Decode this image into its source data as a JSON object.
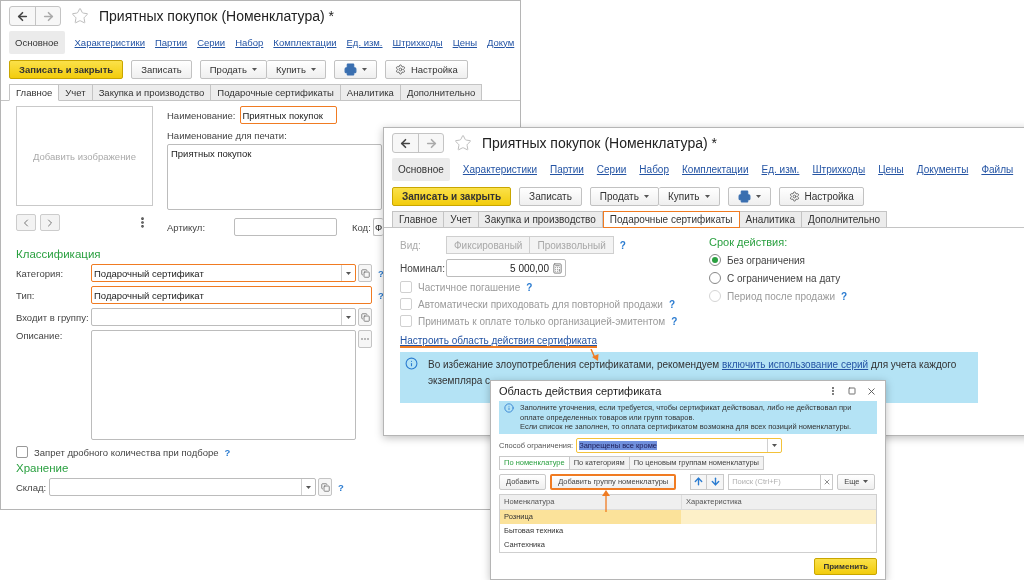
{
  "back_window": {
    "title": "Приятных покупок (Номенклатура) *",
    "nav": [
      {
        "label": "Основное",
        "selected": true
      },
      {
        "label": "Характеристики",
        "selected": false
      },
      {
        "label": "Партии",
        "selected": false
      },
      {
        "label": "Серии",
        "selected": false
      },
      {
        "label": "Набор",
        "selected": false
      },
      {
        "label": "Комплектации",
        "selected": false
      },
      {
        "label": "Ед. изм.",
        "selected": false
      },
      {
        "label": "Штрихкоды",
        "selected": false
      },
      {
        "label": "Цены",
        "selected": false
      },
      {
        "label": "Докум",
        "selected": false
      }
    ],
    "commands": [
      {
        "kind": "primary",
        "label": "Записать и закрыть"
      },
      {
        "kind": "plain",
        "label": "Записать"
      },
      {
        "kind": "menu",
        "label": "Продать"
      },
      {
        "kind": "menu",
        "label": "Купить"
      },
      {
        "kind": "print"
      },
      {
        "kind": "settings",
        "label": "Настройка"
      }
    ],
    "tabs": [
      {
        "label": "Главное",
        "selected": true,
        "highlighted": false
      },
      {
        "label": "Учет",
        "selected": false,
        "highlighted": false
      },
      {
        "label": "Закупка и производство",
        "selected": false,
        "highlighted": false
      },
      {
        "label": "Подарочные сертификаты",
        "selected": false,
        "highlighted": false
      },
      {
        "label": "Аналитика",
        "selected": false,
        "highlighted": false
      },
      {
        "label": "Дополнительно",
        "selected": false,
        "highlighted": false
      }
    ],
    "image_placeholder": "Добавить изображение",
    "name_field": {
      "label": "Наименование:",
      "value": "Приятных покупок",
      "highlighted": true
    },
    "print_name": {
      "label": "Наименование для печати:",
      "value": "Приятных покупок"
    },
    "article": {
      "label": "Артикул:"
    },
    "code": {
      "label": "Код:",
      "value": "Ф"
    },
    "classification": {
      "title": "Классификация",
      "fields": [
        {
          "kind": "select",
          "label": "Категория:",
          "value": "Подарочный сертификат",
          "highlighted": true,
          "help": "?"
        },
        {
          "kind": "text",
          "label": "Тип:",
          "value": "Подарочный сертификат",
          "highlighted": true,
          "help": "?"
        },
        {
          "kind": "select",
          "label": "Входит в группу:",
          "highlighted": false
        },
        {
          "kind": "memo",
          "label": "Описание:",
          "highlighted": false
        }
      ]
    },
    "fractional": {
      "label": "Запрет дробного количества при подборе",
      "checked": false,
      "help": "?"
    },
    "storage": {
      "title": "Хранение",
      "field": {
        "kind": "select",
        "label": "Склад:",
        "highlighted": false,
        "help": "?"
      }
    }
  },
  "front_window": {
    "title": "Приятных покупок (Номенклатура) *",
    "nav": [
      {
        "label": "Основное",
        "selected": true
      },
      {
        "label": "Характеристики",
        "selected": false
      },
      {
        "label": "Партии",
        "selected": false
      },
      {
        "label": "Серии",
        "selected": false
      },
      {
        "label": "Набор",
        "selected": false
      },
      {
        "label": "Комплектации",
        "selected": false
      },
      {
        "label": "Ед. изм.",
        "selected": false
      },
      {
        "label": "Штрихкоды",
        "selected": false
      },
      {
        "label": "Цены",
        "selected": false
      },
      {
        "label": "Документы",
        "selected": false
      },
      {
        "label": "Файлы",
        "selected": false
      }
    ],
    "commands": [
      {
        "kind": "primary",
        "label": "Записать и закрыть"
      },
      {
        "kind": "plain",
        "label": "Записать"
      },
      {
        "kind": "menu",
        "label": "Продать"
      },
      {
        "kind": "menu",
        "label": "Купить"
      },
      {
        "kind": "print"
      },
      {
        "kind": "settings",
        "label": "Настройка"
      }
    ],
    "tabs": [
      {
        "label": "Главное",
        "selected": false,
        "highlighted": false
      },
      {
        "label": "Учет",
        "selected": false,
        "highlighted": false
      },
      {
        "label": "Закупка и производство",
        "selected": false,
        "highlighted": false
      },
      {
        "label": "Подарочные сертификаты",
        "selected": true,
        "highlighted": true
      },
      {
        "label": "Аналитика",
        "selected": false,
        "highlighted": false
      },
      {
        "label": "Дополнительно",
        "selected": false,
        "highlighted": false
      }
    ],
    "kind_field": {
      "label": "Вид:",
      "disabled": true,
      "help": "?",
      "options": [
        {
          "label": "Фиксированый",
          "selected": false
        },
        {
          "label": "Произвольный",
          "selected": false
        }
      ]
    },
    "nominal": {
      "label": "Номинал:",
      "value": "5 000,00"
    },
    "checkboxes": [
      {
        "label": "Частичное погашение",
        "checked": false,
        "disabled": true,
        "help": "?"
      },
      {
        "label": "Автоматически приходовать для повторной продажи",
        "checked": false,
        "disabled": true,
        "help": "?"
      },
      {
        "label": "Принимать к оплате только организацией-эмитентом",
        "checked": false,
        "disabled": true,
        "help": "?"
      }
    ],
    "scope_link": "Настроить область действия сертификата",
    "validity": {
      "title": "Срок действия:",
      "options": [
        {
          "label": "Без ограничения",
          "selected": true,
          "disabled": false
        },
        {
          "label": "С ограничением на дату",
          "selected": false,
          "disabled": false
        },
        {
          "label": "Период после продажи",
          "selected": false,
          "disabled": true,
          "help": "?"
        }
      ]
    },
    "info": {
      "text_before": "Во избежание злоупотребления сертификатами, рекомендуем ",
      "link": "включить использование серий",
      "text_after": " для учета каждого",
      "continuation": "экземпляра с"
    }
  },
  "dialog": {
    "title": "Область действия сертификата",
    "info": [
      "Заполните уточнения, если требуется, чтобы сертификат действовал, либо не действовал при оплате определенных товаров или групп товаров.",
      "Если список не заполнен, то оплата сертификатом возможна для всех позиций номенклатуры."
    ],
    "restriction": {
      "label": "Способ ограничения:",
      "value": "Запрещены все кроме"
    },
    "tabs": [
      {
        "label": "По номенклатуре",
        "selected": true
      },
      {
        "label": "По категориям",
        "selected": false
      },
      {
        "label": "По ценовым группам номенклатуры",
        "selected": false
      }
    ],
    "buttons": [
      {
        "label": "Добавить",
        "highlighted": false
      },
      {
        "label": "Добавить группу номенклатуры",
        "highlighted": true
      }
    ],
    "search": {
      "placeholder": "Поиск (Ctrl+F)"
    },
    "more": "Еще",
    "table": {
      "columns": [
        "Номенклатура",
        "Характеристика"
      ],
      "rows": [
        {
          "name": "Розница",
          "selected": true
        },
        {
          "name": "Бытовая техника",
          "selected": false
        },
        {
          "name": "Сантехника",
          "selected": false
        }
      ]
    },
    "apply": "Применить"
  }
}
